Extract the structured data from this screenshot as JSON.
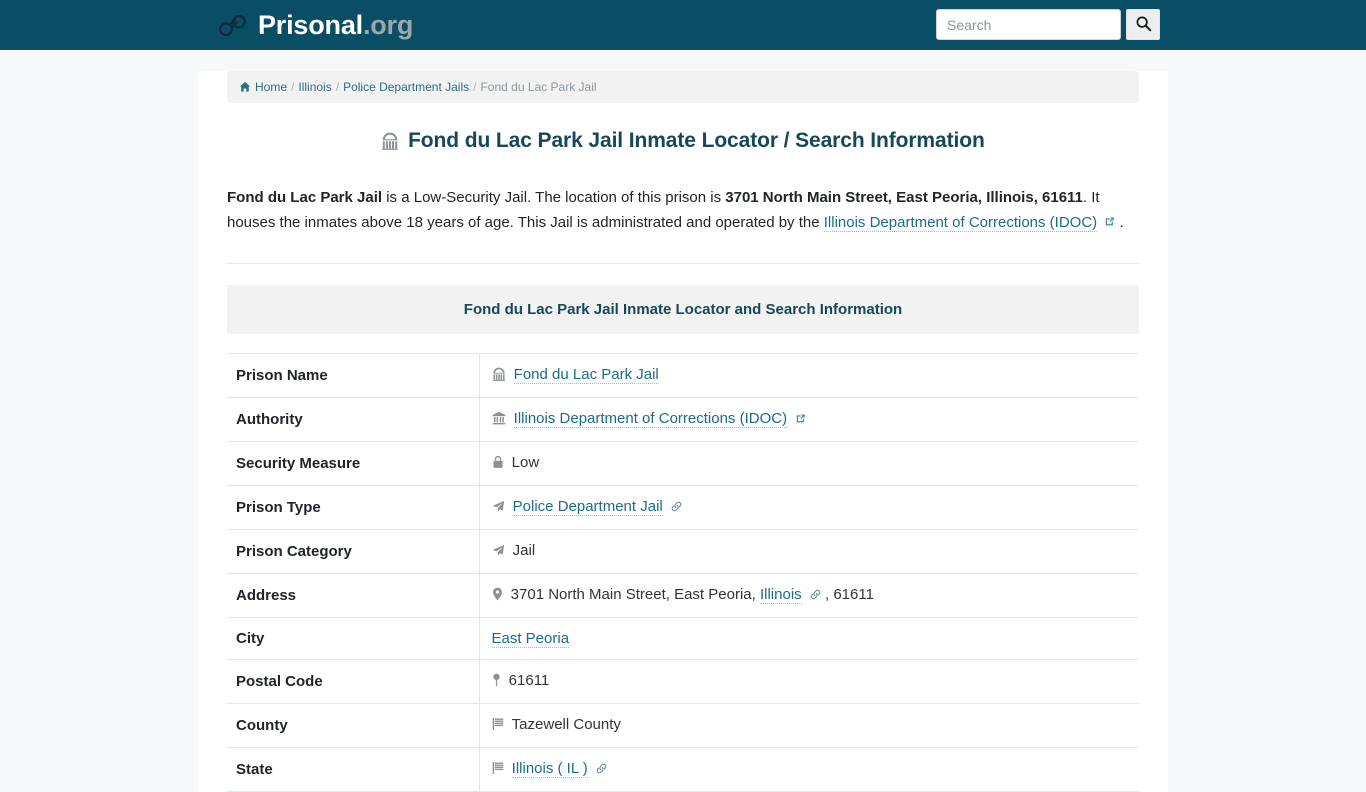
{
  "header": {
    "brand_name": "Prisonal",
    "brand_tld": ".org",
    "logo_icon": "handcuffs-icon",
    "search_placeholder": "Search",
    "search_value": "",
    "search_button_icon": "search-icon"
  },
  "breadcrumb": {
    "home_icon": "home-icon",
    "items": [
      {
        "label": "Home",
        "link": true
      },
      {
        "label": "Illinois",
        "link": true
      },
      {
        "label": "Police Department Jails",
        "link": true
      },
      {
        "label": "Fond du Lac Park Jail",
        "link": false
      }
    ],
    "separator": "/"
  },
  "page": {
    "title": "Fond du Lac Park Jail Inmate Locator / Search Information",
    "title_icon": "landmark-icon",
    "intro": {
      "seg1_bold": "Fond du Lac Park Jail",
      "seg2": " is a Low-Security Jail. The location of this prison is ",
      "seg3_bold": "3701 North Main Street, East Peoria, Illinois, 61611",
      "seg4": ". It houses the inmates above 18 years of age. This Jail is administrated and operated by the ",
      "link_text": "Illinois Department of Corrections (IDOC)",
      "link_icon": "external-link-icon",
      "seg5": "."
    }
  },
  "table": {
    "caption": "Fond du Lac Park Jail Inmate Locator and Search Information",
    "rows": [
      {
        "label": "Prison Name",
        "icon": "landmark-icon",
        "value": "Fond du Lac Park Jail",
        "value_is_link": true,
        "trailing_icon": ""
      },
      {
        "label": "Authority",
        "icon": "bank-icon",
        "value": "Illinois Department of Corrections (IDOC)",
        "value_is_link": true,
        "trailing_icon": "external-link-icon"
      },
      {
        "label": "Security Measure",
        "icon": "lock-icon",
        "value": "Low",
        "value_is_link": false,
        "trailing_icon": ""
      },
      {
        "label": "Prison Type",
        "icon": "paper-plane-icon",
        "value": "Police Department Jail",
        "value_is_link": true,
        "trailing_icon": "link-icon"
      },
      {
        "label": "Prison Category",
        "icon": "paper-plane-icon",
        "value": "Jail",
        "value_is_link": false,
        "trailing_icon": ""
      },
      {
        "label": "Address",
        "icon": "map-marker-icon",
        "value": "3701 North Main Street, East Peoria, ",
        "value_is_link": false,
        "inline_link": "Illinois",
        "inline_link_icon": "link-icon",
        "value_tail": ", 61611",
        "trailing_icon": ""
      },
      {
        "label": "City",
        "icon": "",
        "value": "East Peoria",
        "value_is_link": true,
        "trailing_icon": ""
      },
      {
        "label": "Postal Code",
        "icon": "map-pin-icon",
        "value": "61611",
        "value_is_link": false,
        "trailing_icon": ""
      },
      {
        "label": "County",
        "icon": "flag-icon",
        "value": "Tazewell County",
        "value_is_link": false,
        "trailing_icon": ""
      },
      {
        "label": "State",
        "icon": "flag-icon",
        "value": "Illinois ( IL )",
        "value_is_link": true,
        "trailing_icon": "link-icon"
      }
    ]
  },
  "colors": {
    "header_bg": "#0a4e66",
    "page_bg": "#f6f8fa",
    "content_bg": "#ffffff",
    "heading": "#16485c",
    "link": "#1c6c88",
    "band": "#f2f2f2",
    "border": "#e3e6e8",
    "icon_gray": "#8c9196"
  }
}
